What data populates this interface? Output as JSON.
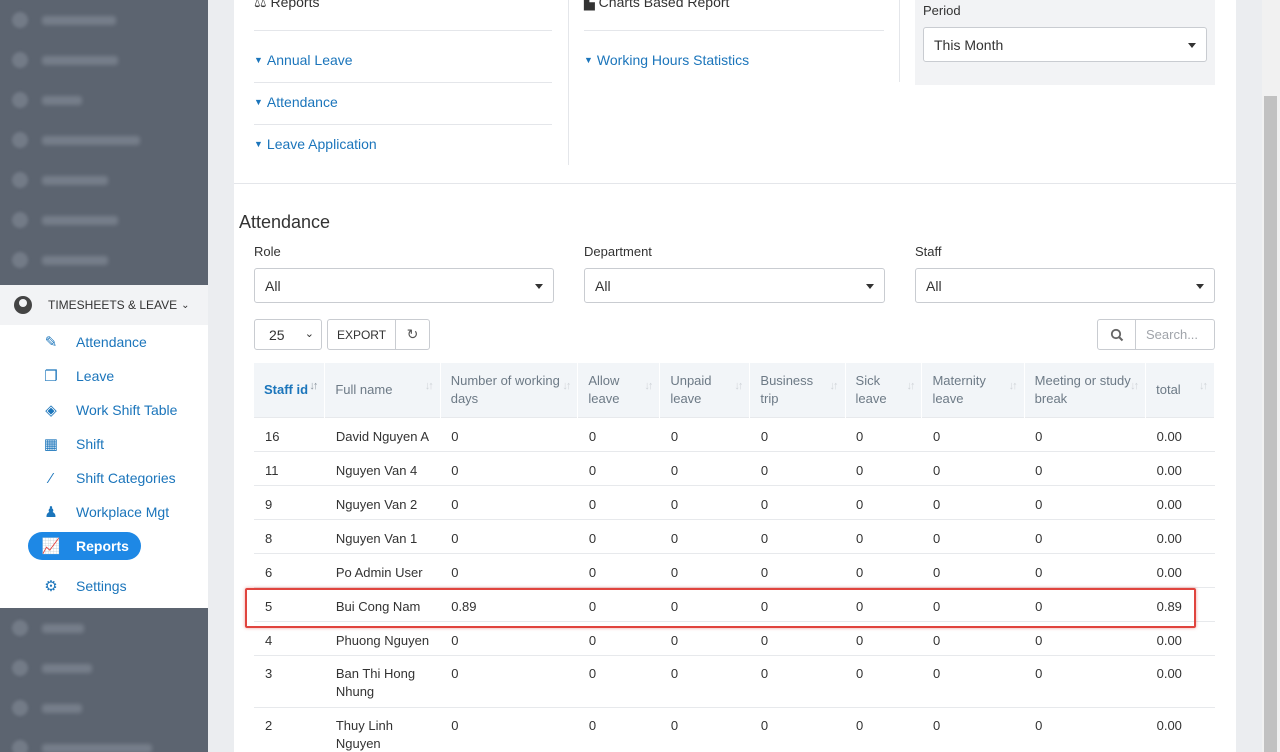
{
  "sidebar": {
    "blurred_top_count": 7,
    "section": {
      "title": "TIMESHEETS & LEAVE",
      "items": [
        {
          "label": "Attendance",
          "icon": "edit-icon",
          "glyph": "✎"
        },
        {
          "label": "Leave",
          "icon": "file-copy-icon",
          "glyph": "❐"
        },
        {
          "label": "Work Shift Table",
          "icon": "tag-icon",
          "glyph": "◈"
        },
        {
          "label": "Shift",
          "icon": "calendar-icon",
          "glyph": "▦"
        },
        {
          "label": "Shift Categories",
          "icon": "magic-wand-icon",
          "glyph": "⁄"
        },
        {
          "label": "Workplace Mgt",
          "icon": "user-pin-icon",
          "glyph": "♟"
        },
        {
          "label": "Reports",
          "icon": "chart-line-icon",
          "glyph": "📈",
          "active": true
        },
        {
          "label": "Settings",
          "icon": "gears-icon",
          "glyph": "⚙"
        }
      ]
    }
  },
  "reports": {
    "col1_title": "Reports",
    "col2_title": "Charts Based Report",
    "links_col1": [
      "Annual Leave",
      "Attendance",
      "Leave Application"
    ],
    "links_col2": [
      "Working Hours Statistics"
    ],
    "period_label": "Period",
    "period_value": "This Month"
  },
  "attendance": {
    "title": "Attendance",
    "filters": {
      "role_label": "Role",
      "role_value": "All",
      "department_label": "Department",
      "department_value": "All",
      "staff_label": "Staff",
      "staff_value": "All"
    },
    "page_length": "25",
    "export_label": "EXPORT",
    "search_placeholder": "Search...",
    "columns": [
      "Staff id",
      "Full name",
      "Number of working days",
      "Allow leave",
      "Unpaid leave",
      "Business trip",
      "Sick leave",
      "Maternity leave",
      "Meeting or study break",
      "total"
    ],
    "rows": [
      [
        "16",
        "David Nguyen A",
        "0",
        "0",
        "0",
        "0",
        "0",
        "0",
        "0",
        "0.00"
      ],
      [
        "11",
        "Nguyen Van 4",
        "0",
        "0",
        "0",
        "0",
        "0",
        "0",
        "0",
        "0.00"
      ],
      [
        "9",
        "Nguyen Van 2",
        "0",
        "0",
        "0",
        "0",
        "0",
        "0",
        "0",
        "0.00"
      ],
      [
        "8",
        "Nguyen Van 1",
        "0",
        "0",
        "0",
        "0",
        "0",
        "0",
        "0",
        "0.00"
      ],
      [
        "6",
        "Po Admin User",
        "0",
        "0",
        "0",
        "0",
        "0",
        "0",
        "0",
        "0.00"
      ],
      [
        "5",
        "Bui Cong Nam",
        "0.89",
        "0",
        "0",
        "0",
        "0",
        "0",
        "0",
        "0.89"
      ],
      [
        "4",
        "Phuong Nguyen",
        "0",
        "0",
        "0",
        "0",
        "0",
        "0",
        "0",
        "0.00"
      ],
      [
        "3",
        "Ban Thi Hong Nhung",
        "0",
        "0",
        "0",
        "0",
        "0",
        "0",
        "0",
        "0.00"
      ],
      [
        "2",
        "Thuy Linh Nguyen",
        "0",
        "0",
        "0",
        "0",
        "0",
        "0",
        "0",
        "0.00"
      ]
    ]
  }
}
